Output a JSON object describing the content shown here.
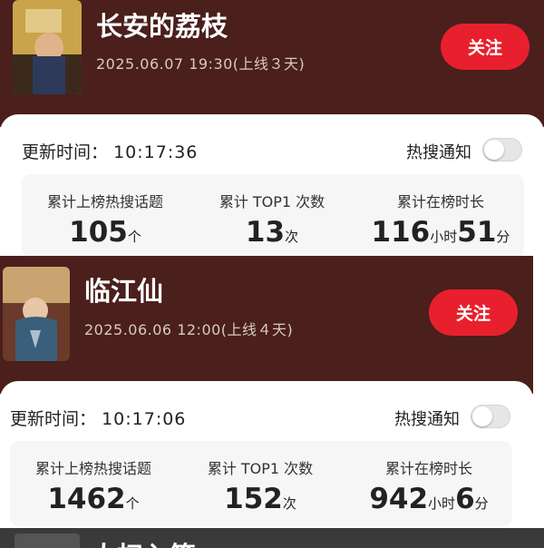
{
  "items": [
    {
      "title": "长安的荔枝",
      "date": "2025.06.07 19:30(上线３天)",
      "follow_label": "关注",
      "update_label": "更新时间：",
      "update_time": "10:17:36",
      "hot_label": "热搜通知",
      "hot_notify_on": false,
      "stats": [
        {
          "label": "累计上榜热搜话题",
          "value": "105",
          "unit": "个"
        },
        {
          "label": "累计 TOP1 次数",
          "value": "13",
          "unit": "次"
        },
        {
          "label": "累计在榜时长",
          "hours": "116",
          "hours_unit": "小时",
          "minutes": "51",
          "minutes_unit": "分"
        }
      ]
    },
    {
      "title": "临江仙",
      "date": "2025.06.06 12:00(上线４天)",
      "follow_label": "关注",
      "update_label": "更新时间：",
      "update_time": "10:17:06",
      "hot_label": "热搜通知",
      "hot_notify_on": false,
      "stats": [
        {
          "label": "累计上榜热搜话题",
          "value": "1462",
          "unit": "个"
        },
        {
          "label": "累计 TOP1 次数",
          "value": "152",
          "unit": "次"
        },
        {
          "label": "累计在榜时长",
          "hours": "942",
          "hours_unit": "小时",
          "minutes": "6",
          "minutes_unit": "分"
        }
      ]
    },
    {
      "title": "人扫入签"
    }
  ],
  "colors": {
    "header_bg": "#4a1f1c",
    "follow_button": "#e8202e",
    "stats_bg": "#f6f6f6"
  }
}
